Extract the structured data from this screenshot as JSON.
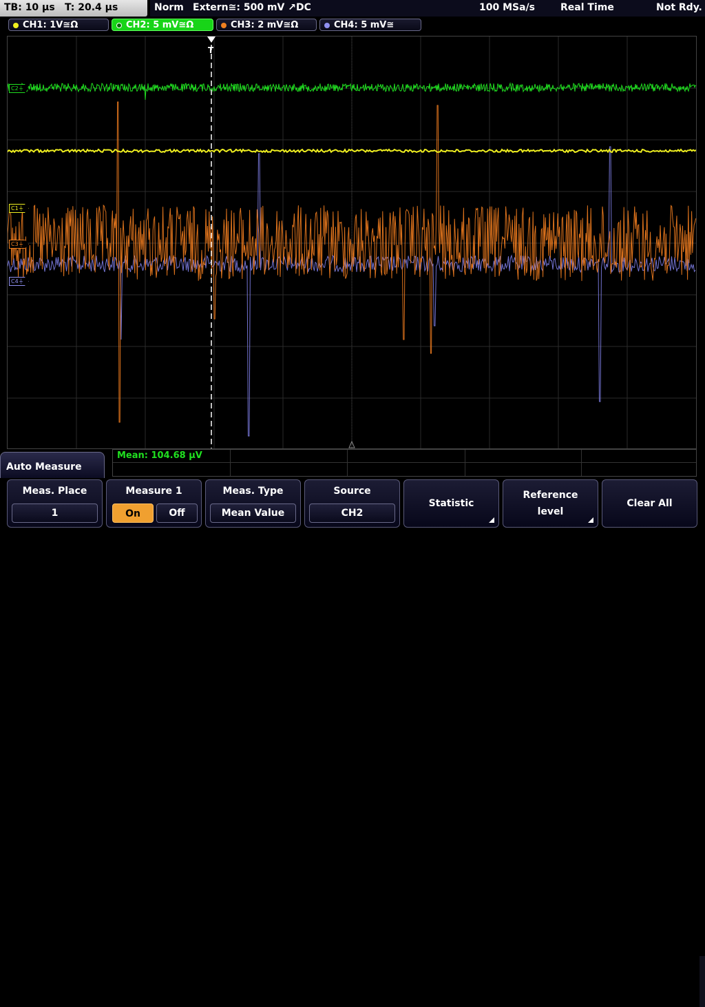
{
  "topbar": {
    "timebase": "TB: 10 µs",
    "trigger_time": "T: 20.4 µs",
    "mode": "Norm",
    "trigger": "Extern≅: 500 mV ↗DC",
    "sample_rate": "100 MSa/s",
    "acq_mode": "Real Time",
    "status": "Not Rdy."
  },
  "channels": [
    {
      "label": "CH1: 1V≅Ω",
      "color": "#f0f020"
    },
    {
      "label": "CH2: 5 mV≅Ω",
      "color": "#20e020"
    },
    {
      "label": "CH3: 2 mV≅Ω",
      "color": "#f08020"
    },
    {
      "label": "CH4: 5 mV≅",
      "color": "#9090f0"
    }
  ],
  "markers": {
    "c1": "C1⏚",
    "c2": "C2⏚",
    "c3": "C3⏚",
    "c4": "C4⏚",
    "trigger": "T"
  },
  "measurement": {
    "mean": "Mean: 104.68 µV"
  },
  "menu": {
    "title": "Auto Measure",
    "meas_place_label": "Meas. Place",
    "meas_place_value": "1",
    "measure1_label": "Measure 1",
    "on": "On",
    "off": "Off",
    "meas_type_label": "Meas. Type",
    "meas_type_value": "Mean Value",
    "source_label": "Source",
    "source_value": "CH2",
    "statistic": "Statistic",
    "reference_level_1": "Reference",
    "reference_level_2": "level",
    "clear_all": "Clear All"
  }
}
